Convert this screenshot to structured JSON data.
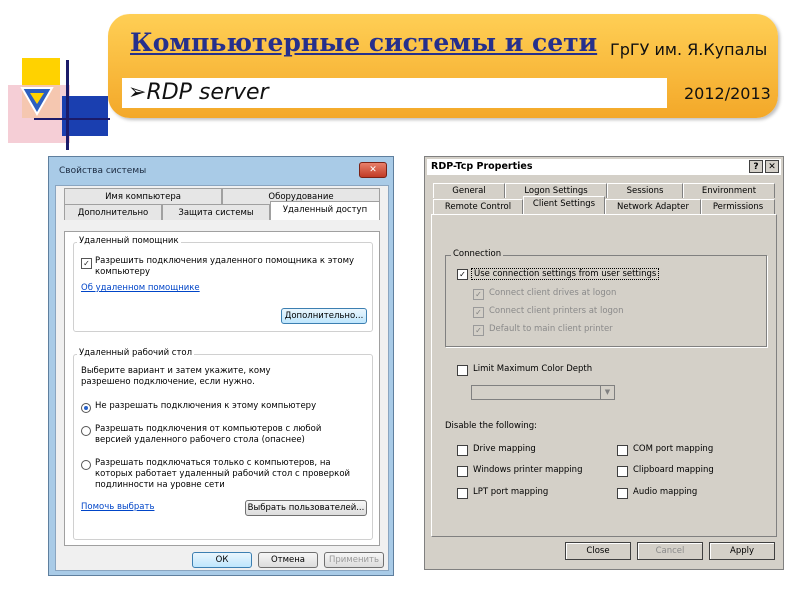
{
  "slide": {
    "title": "Компьютерные системы и сети",
    "organization": "ГрГУ им. Я.Купалы",
    "subtitle": "RDP server",
    "year": "2012/2013"
  },
  "left_dialog": {
    "title": "Свойства системы",
    "close_label": "✕",
    "tabs_row1": [
      "Имя компьютера",
      "Оборудование"
    ],
    "tabs_row2": [
      "Дополнительно",
      "Защита системы",
      "Удаленный доступ"
    ],
    "remote_assistance": {
      "group_label": "Удаленный помощник",
      "checkbox_label": "Разрешить подключения удаленного помощника к этому компьютеру",
      "checkbox_checked": true,
      "link": "Об удаленном помощнике",
      "advanced_button": "Дополнительно..."
    },
    "remote_desktop": {
      "group_label": "Удаленный рабочий стол",
      "description": "Выберите вариант и затем укажите, кому разрешено подключение, если нужно.",
      "options": [
        "Не разрешать подключения к этому компьютеру",
        "Разрешать подключения от компьютеров с любой версией удаленного рабочего стола (опаснее)",
        "Разрешать подключаться только с компьютеров, на которых работает удаленный рабочий стол с проверкой подлинности на уровне сети"
      ],
      "selected_option": 0,
      "help_link": "Помочь выбрать",
      "select_users_button": "Выбрать пользователей..."
    },
    "buttons": {
      "ok": "ОК",
      "cancel": "Отмена",
      "apply": "Применить"
    }
  },
  "right_dialog": {
    "title": "RDP-Tcp Properties",
    "help_label": "?",
    "close_label": "✕",
    "tabs_row1": [
      "General",
      "Logon Settings",
      "Sessions",
      "Environment"
    ],
    "tabs_row2": [
      "Remote Control",
      "Client Settings",
      "Network Adapter",
      "Permissions"
    ],
    "connection": {
      "group_label": "Connection",
      "use_user_settings": "Use connection settings from user settings",
      "items": [
        "Connect client drives at logon",
        "Connect client printers at logon",
        "Default to main client printer"
      ]
    },
    "limit_color_depth": "Limit Maximum Color Depth",
    "disable_label": "Disable the following:",
    "disable_items_left": [
      "Drive mapping",
      "Windows printer mapping",
      "LPT port mapping"
    ],
    "disable_items_right": [
      "COM port mapping",
      "Clipboard mapping",
      "Audio mapping"
    ],
    "buttons": {
      "close": "Close",
      "cancel": "Cancel",
      "apply": "Apply"
    }
  }
}
